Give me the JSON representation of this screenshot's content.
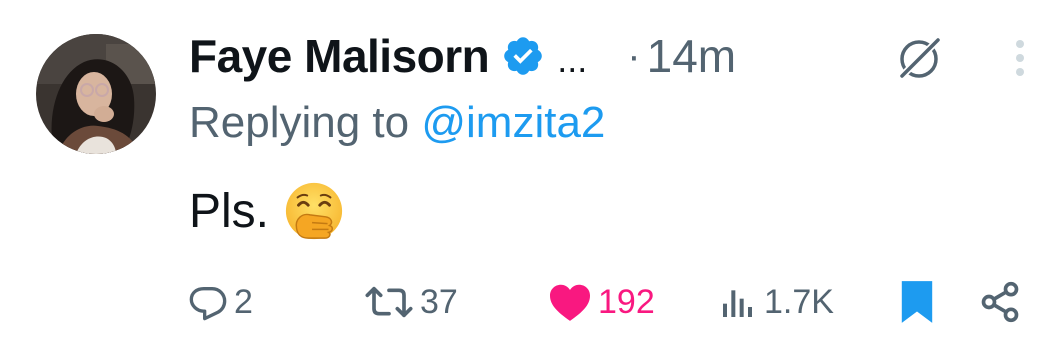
{
  "tweet": {
    "author_name": "Faye Malisorn",
    "ellipsis": "...",
    "separator": "·",
    "time": "14m",
    "replying_prefix": "Replying to ",
    "replying_handle": "@imzita2",
    "text": "Pls.",
    "emoji": "face-with-hand-over-mouth"
  },
  "actions": {
    "reply_count": "2",
    "retweet_count": "37",
    "like_count": "192",
    "views_count": "1.7K"
  },
  "icons": {
    "verified": "verified-badge-icon",
    "grok": "grok-icon",
    "more": "more-icon",
    "reply": "reply-icon",
    "retweet": "retweet-icon",
    "like": "heart-icon",
    "views": "views-icon",
    "bookmark": "bookmark-icon",
    "share": "share-icon"
  },
  "colors": {
    "text": "#0f1419",
    "secondary": "#536471",
    "accent": "#1d9bf0",
    "like": "#f91880"
  }
}
